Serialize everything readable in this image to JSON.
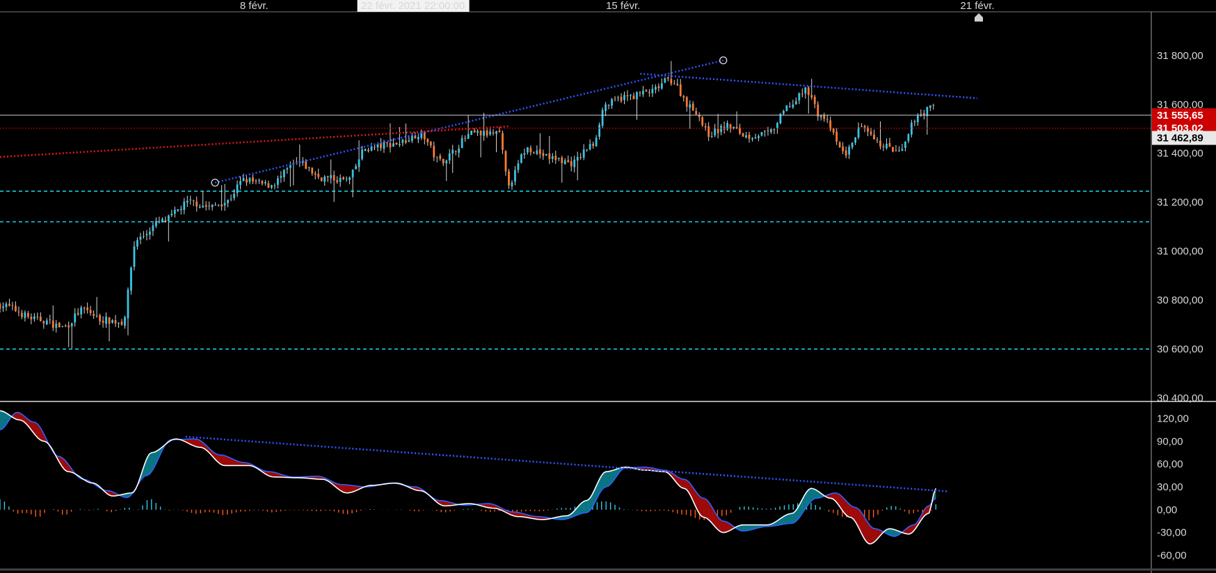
{
  "timeline": {
    "labels": [
      {
        "text": "8 févr.",
        "day": 5.2
      },
      {
        "text": "15 févr.",
        "day": 12.75
      },
      {
        "text": "21 févr.",
        "day": 20.0
      }
    ],
    "cursor_label": "22 févr. 2021 22:00:00",
    "cursor_day": 8.45
  },
  "colors": {
    "background": "#000000",
    "bull": "#35c6e6",
    "bear": "#ff7a30",
    "wick": "#d8d8d8",
    "trend_blue": "#2f55ff",
    "trend_red": "#e01818",
    "support_cyan": "#19d4e8",
    "last_price_tag": "#cc0000",
    "secondary_tag": "#e8e8e8",
    "macd_line": "#2d62ff",
    "signal_line": "#ffffff",
    "fill_bull": "#0b7a8a",
    "fill_bear": "#a50b0b",
    "hist_pos": "#35c6e6",
    "hist_neg": "#ff5a1a"
  },
  "chart_data": [
    {
      "type": "candlestick",
      "panel": "price",
      "ylim": [
        30400,
        31950
      ],
      "yticks": [
        "31 800,00",
        "31 600,00",
        "31 400,00",
        "31 200,00",
        "31 000,00",
        "30 800,00",
        "30 600,00",
        "30 400,00"
      ],
      "ytick_values": [
        31800,
        31600,
        31400,
        31200,
        31000,
        30800,
        30600,
        30400
      ],
      "last_price": {
        "label": "31 555,65",
        "value": 31555.65
      },
      "secondary_price": {
        "label": "31 503,02",
        "value": 31503.02
      },
      "cursor_price": {
        "label": "31 462,89",
        "value": 31462.89
      },
      "horizontal_lines": [
        31245,
        31120,
        30600
      ],
      "trendlines": [
        {
          "color": "blue",
          "points": [
            [
              4.4,
              31280
            ],
            [
              14.8,
              31780
            ]
          ]
        },
        {
          "color": "blue",
          "points": [
            [
              13.1,
              31725
            ],
            [
              20.0,
              31625
            ]
          ]
        },
        {
          "color": "red",
          "points": [
            [
              0.0,
              31385
            ],
            [
              10.4,
              31510
            ]
          ]
        }
      ],
      "markers": [
        [
          4.4,
          31280
        ],
        [
          14.8,
          31780
        ]
      ],
      "anchors": [
        [
          0.0,
          30780
        ],
        [
          0.8,
          30720
        ],
        [
          1.3,
          30690
        ],
        [
          1.7,
          30760
        ],
        [
          2.1,
          30720
        ],
        [
          2.5,
          30710
        ],
        [
          2.8,
          31050
        ],
        [
          3.3,
          31120
        ],
        [
          3.9,
          31200
        ],
        [
          4.3,
          31180
        ],
        [
          4.6,
          31200
        ],
        [
          5.0,
          31290
        ],
        [
          5.5,
          31270
        ],
        [
          6.1,
          31360
        ],
        [
          6.6,
          31300
        ],
        [
          7.1,
          31290
        ],
        [
          7.5,
          31420
        ],
        [
          8.1,
          31440
        ],
        [
          8.6,
          31480
        ],
        [
          9.0,
          31370
        ],
        [
          9.7,
          31480
        ],
        [
          10.2,
          31480
        ],
        [
          10.4,
          31280
        ],
        [
          10.8,
          31420
        ],
        [
          11.3,
          31380
        ],
        [
          11.7,
          31360
        ],
        [
          12.1,
          31430
        ],
        [
          12.4,
          31600
        ],
        [
          12.8,
          31630
        ],
        [
          13.3,
          31650
        ],
        [
          13.7,
          31700
        ],
        [
          14.2,
          31580
        ],
        [
          14.5,
          31480
        ],
        [
          14.9,
          31510
        ],
        [
          15.3,
          31470
        ],
        [
          15.7,
          31480
        ],
        [
          16.2,
          31600
        ],
        [
          16.5,
          31660
        ],
        [
          16.8,
          31550
        ],
        [
          17.3,
          31400
        ],
        [
          17.6,
          31500
        ],
        [
          18.0,
          31440
        ],
        [
          18.4,
          31400
        ],
        [
          18.8,
          31560
        ],
        [
          19.1,
          31590
        ]
      ],
      "candle_count": 300,
      "seed": 7
    },
    {
      "type": "macd",
      "panel": "indicator",
      "ylim": [
        -75,
        135
      ],
      "yticks": [
        "120,00",
        "90,00",
        "60,00",
        "30,00",
        "0,00",
        "-30,00",
        "-60,00"
      ],
      "ytick_values": [
        120,
        90,
        60,
        30,
        0,
        -30,
        -60
      ],
      "trendline": {
        "color": "blue",
        "points": [
          [
            3.8,
            96
          ],
          [
            19.4,
            24
          ]
        ]
      },
      "signal_anchors": [
        [
          0.0,
          105
        ],
        [
          0.35,
          128
        ],
        [
          0.7,
          115
        ],
        [
          1.2,
          70
        ],
        [
          1.7,
          40
        ],
        [
          2.2,
          25
        ],
        [
          2.6,
          16
        ],
        [
          3.0,
          45
        ],
        [
          3.5,
          92
        ],
        [
          4.0,
          93
        ],
        [
          4.5,
          72
        ],
        [
          5.0,
          62
        ],
        [
          5.5,
          50
        ],
        [
          6.0,
          43
        ],
        [
          6.5,
          44
        ],
        [
          7.0,
          33
        ],
        [
          7.5,
          30
        ],
        [
          8.0,
          35
        ],
        [
          8.5,
          30
        ],
        [
          9.0,
          12
        ],
        [
          9.5,
          6
        ],
        [
          10.0,
          8
        ],
        [
          10.5,
          -3
        ],
        [
          11.0,
          -9
        ],
        [
          11.5,
          -13
        ],
        [
          12.0,
          -4
        ],
        [
          12.4,
          30
        ],
        [
          12.8,
          55
        ],
        [
          13.2,
          56
        ],
        [
          13.6,
          52
        ],
        [
          14.0,
          40
        ],
        [
          14.4,
          15
        ],
        [
          14.8,
          -15
        ],
        [
          15.2,
          -28
        ],
        [
          15.7,
          -22
        ],
        [
          16.2,
          -18
        ],
        [
          16.7,
          15
        ],
        [
          17.1,
          22
        ],
        [
          17.5,
          3
        ],
        [
          17.9,
          -25
        ],
        [
          18.3,
          -35
        ],
        [
          18.7,
          -20
        ],
        [
          19.0,
          5
        ],
        [
          19.15,
          15
        ]
      ],
      "macd_anchors": [
        [
          0.0,
          130
        ],
        [
          0.4,
          118
        ],
        [
          0.9,
          90
        ],
        [
          1.4,
          50
        ],
        [
          1.9,
          35
        ],
        [
          2.3,
          18
        ],
        [
          2.7,
          22
        ],
        [
          3.1,
          75
        ],
        [
          3.6,
          93
        ],
        [
          4.1,
          82
        ],
        [
          4.6,
          58
        ],
        [
          5.1,
          58
        ],
        [
          5.6,
          43
        ],
        [
          6.1,
          42
        ],
        [
          6.6,
          40
        ],
        [
          7.1,
          22
        ],
        [
          7.6,
          32
        ],
        [
          8.1,
          35
        ],
        [
          8.6,
          25
        ],
        [
          9.1,
          5
        ],
        [
          9.6,
          8
        ],
        [
          10.1,
          2
        ],
        [
          10.6,
          -9
        ],
        [
          11.1,
          -13
        ],
        [
          11.6,
          -8
        ],
        [
          12.0,
          12
        ],
        [
          12.4,
          50
        ],
        [
          12.8,
          56
        ],
        [
          13.2,
          52
        ],
        [
          13.6,
          50
        ],
        [
          14.0,
          28
        ],
        [
          14.4,
          -10
        ],
        [
          14.8,
          -30
        ],
        [
          15.2,
          -20
        ],
        [
          15.7,
          -20
        ],
        [
          16.2,
          -5
        ],
        [
          16.6,
          28
        ],
        [
          17.0,
          15
        ],
        [
          17.4,
          -10
        ],
        [
          17.8,
          -45
        ],
        [
          18.2,
          -25
        ],
        [
          18.6,
          -32
        ],
        [
          19.0,
          -5
        ],
        [
          19.15,
          28
        ]
      ]
    }
  ]
}
